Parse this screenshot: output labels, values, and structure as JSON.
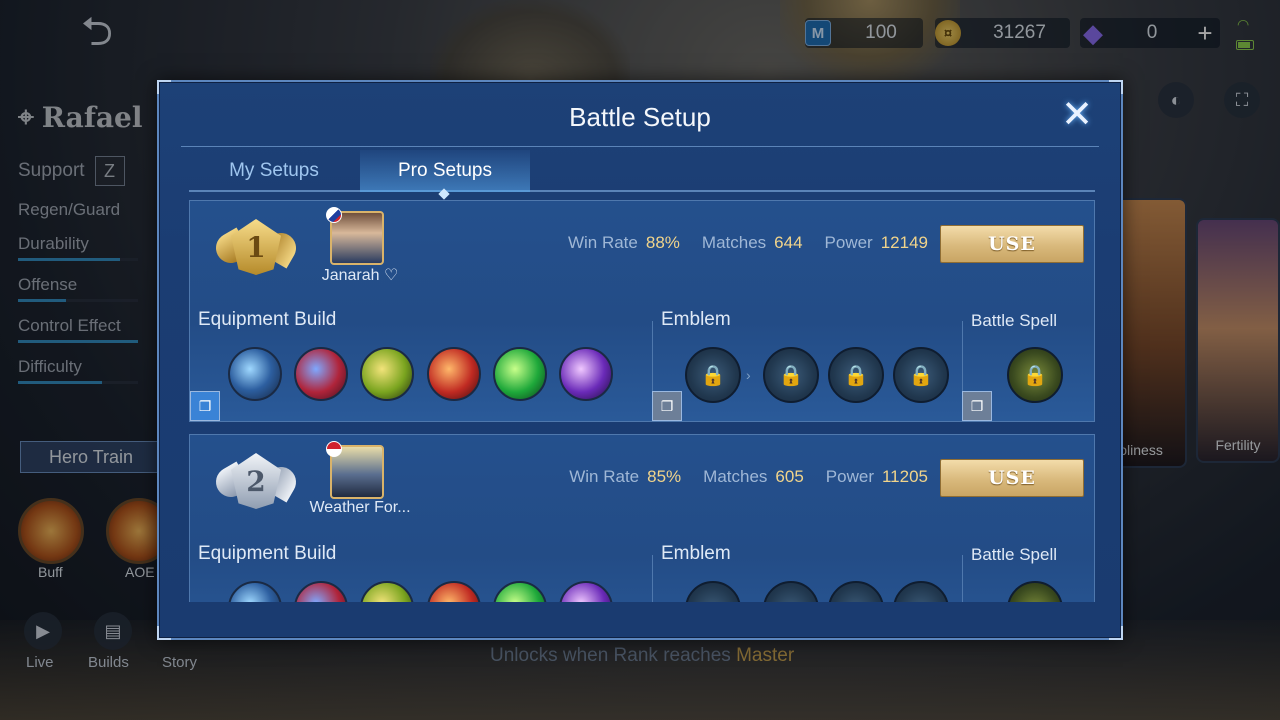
{
  "background": {
    "hero": {
      "name": "Rafael",
      "role": "Support",
      "stats": [
        {
          "label": "Regen/Guard",
          "fill": 0
        },
        {
          "label": "Durability",
          "fill": 0.85
        },
        {
          "label": "Offense",
          "fill": 0.4
        },
        {
          "label": "Control Effect",
          "fill": 1.0
        },
        {
          "label": "Difficulty",
          "fill": 0.7
        }
      ],
      "train_label": "Hero Train",
      "skills": [
        "Buff",
        "AOE"
      ],
      "bottom_buttons": [
        "Live",
        "Builds",
        "Story"
      ]
    },
    "unlock_hint": {
      "text": "Unlocks when Rank reaches",
      "rank": "Master"
    },
    "skins": [
      "Holiness",
      "Fertility"
    ]
  },
  "currency": {
    "tickets": "100",
    "gold": "31267",
    "diamonds": "0",
    "add_label": "+"
  },
  "modal": {
    "title": "Battle Setup",
    "close_label": "✕",
    "tabs": [
      {
        "label": "My Setups",
        "active": false
      },
      {
        "label": "Pro Setups",
        "active": true
      }
    ],
    "setups": [
      {
        "rank": "1",
        "player": "Janarah ♡",
        "win_rate_label": "Win Rate",
        "win_rate": "88%",
        "matches_label": "Matches",
        "matches": "644",
        "power_label": "Power",
        "power": "12149",
        "use_label": "USE",
        "equipment_label": "Equipment Build",
        "emblem_label": "Emblem",
        "spell_label": "Battle Spell"
      },
      {
        "rank": "2",
        "player": "Weather For...",
        "win_rate_label": "Win Rate",
        "win_rate": "85%",
        "matches_label": "Matches",
        "matches": "605",
        "power_label": "Power",
        "power": "11205",
        "use_label": "USE",
        "equipment_label": "Equipment Build",
        "emblem_label": "Emblem",
        "spell_label": "Battle Spell"
      }
    ]
  },
  "colors": {
    "modal_bg": "#1b3d73",
    "accent_gold": "#f1d48b",
    "tab_active": "#5aaaf0"
  }
}
